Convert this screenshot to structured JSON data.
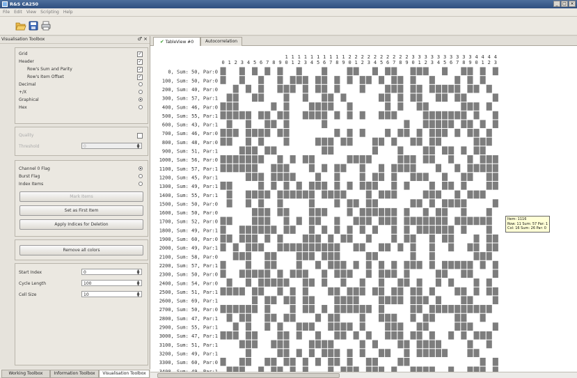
{
  "window": {
    "title": "R&S CA250",
    "controls": [
      "_",
      "□",
      "×"
    ]
  },
  "menu": [
    "File",
    "Edit",
    "View",
    "Scripting",
    "Help"
  ],
  "toolbar_icons": [
    "open-folder-icon",
    "save-icon",
    "print-icon"
  ],
  "panel": {
    "title": "Visualisation Toolbox",
    "controls": "♂ ×",
    "display_options": [
      {
        "label": "Grid",
        "control": "checkbox",
        "checked": true,
        "indent": false
      },
      {
        "label": "Header",
        "control": "checkbox",
        "checked": true,
        "indent": false
      },
      {
        "label": "Row's Sum and Parity",
        "control": "checkbox",
        "checked": true,
        "indent": true
      },
      {
        "label": "Row's Item Offset",
        "control": "checkbox",
        "checked": true,
        "indent": true
      },
      {
        "label": "Decimal",
        "control": "radio",
        "checked": false,
        "indent": false
      },
      {
        "label": "+/X",
        "control": "radio",
        "checked": false,
        "indent": false
      },
      {
        "label": "Graphical",
        "control": "radio",
        "checked": true,
        "indent": false
      },
      {
        "label": "Hex",
        "control": "radio",
        "checked": false,
        "indent": false
      }
    ],
    "quality": {
      "label": "Quality",
      "threshold_label": "Threshold",
      "threshold_value": "0"
    },
    "flags": [
      {
        "label": "Channel 0 Flag",
        "checked": true
      },
      {
        "label": "Burst Flag",
        "checked": false
      },
      {
        "label": "Index Items",
        "checked": false
      }
    ],
    "buttons": {
      "mark_items": "Mark Items",
      "set_first": "Set as First Item",
      "apply_indices": "Apply Indices for Deletion",
      "remove_colors": "Remove all colors"
    },
    "params": [
      {
        "label": "Start Index",
        "value": "0"
      },
      {
        "label": "Cycle Length",
        "value": "100"
      },
      {
        "label": "Cell Size",
        "value": "10"
      }
    ]
  },
  "bottom_tabs": [
    "Working Toolbox",
    "Information Toolbox",
    "Visualisation Toolbox"
  ],
  "tabs": [
    {
      "label": "TableView #0",
      "active": true
    },
    {
      "label": "Autocorrelation",
      "active": false
    }
  ],
  "tooltip": {
    "lines": [
      "Item: 1116",
      "Row: 11 Sum: 57 Par: 1",
      "Col: 16 Sum: 26 Par: 0"
    ]
  },
  "table": {
    "column_headers": [
      "0",
      "1",
      "2",
      "3",
      "4",
      "5",
      "6",
      "7",
      "8",
      "9",
      "10",
      "11",
      "12",
      "13",
      "14",
      "15",
      "16",
      "17",
      "18",
      "19",
      "20",
      "21",
      "22",
      "23",
      "24",
      "25",
      "26",
      "27",
      "28",
      "29",
      "30",
      "31",
      "32",
      "33",
      "34",
      "35",
      "36",
      "37",
      "38",
      "39",
      "40",
      "41",
      "42",
      "43"
    ],
    "rows": [
      {
        "label": "0, Sum: 50, Par:0"
      },
      {
        "label": "100, Sum: 50, Par:0"
      },
      {
        "label": "200, Sum: 40, Par:0"
      },
      {
        "label": "300, Sum: 57, Par:1"
      },
      {
        "label": "400, Sum: 46, Par:0"
      },
      {
        "label": "500, Sum: 55, Par:1"
      },
      {
        "label": "600, Sum: 43, Par:1"
      },
      {
        "label": "700, Sum: 46, Par:0"
      },
      {
        "label": "800, Sum: 48, Par:0"
      },
      {
        "label": "900, Sum: 51, Par:1"
      },
      {
        "label": "1000, Sum: 56, Par:0"
      },
      {
        "label": "1100, Sum: 57, Par:1"
      },
      {
        "label": "1200, Sum: 45, Par:1"
      },
      {
        "label": "1300, Sum: 49, Par:1"
      },
      {
        "label": "1400, Sum: 55, Par:1"
      },
      {
        "label": "1500, Sum: 50, Par:0"
      },
      {
        "label": "1600, Sum: 50, Par:0"
      },
      {
        "label": "1700, Sum: 52, Par:0"
      },
      {
        "label": "1800, Sum: 49, Par:1"
      },
      {
        "label": "1900, Sum: 60, Par:0"
      },
      {
        "label": "2000, Sum: 49, Par:1"
      },
      {
        "label": "2100, Sum: 58, Par:0"
      },
      {
        "label": "2200, Sum: 57, Par:1"
      },
      {
        "label": "2300, Sum: 50, Par:0"
      },
      {
        "label": "2400, Sum: 54, Par:0"
      },
      {
        "label": "2500, Sum: 51, Par:1"
      },
      {
        "label": "2600, Sum: 69, Par:1"
      },
      {
        "label": "2700, Sum: 50, Par:0"
      },
      {
        "label": "2800, Sum: 47, Par:1"
      },
      {
        "label": "2900, Sum: 55, Par:1"
      },
      {
        "label": "3000, Sum: 47, Par:1"
      },
      {
        "label": "3100, Sum: 51, Par:1"
      },
      {
        "label": "3200, Sum: 49, Par:1"
      },
      {
        "label": "3300, Sum: 60, Par:0"
      },
      {
        "label": "3400, Sum: 49, Par:1"
      }
    ]
  },
  "colors": {
    "cell_on": "#7d7d7d",
    "cell_off": "#ffffff",
    "tab_check": "#3a9e2e",
    "title_bar": "#2e4f7f"
  }
}
